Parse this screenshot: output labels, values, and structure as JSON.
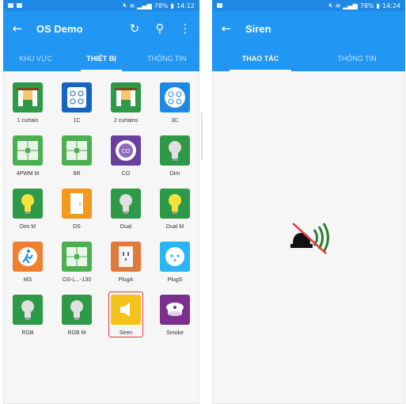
{
  "left_phone": {
    "status_time": "14:12",
    "status_battery": "78%",
    "title": "OS Demo",
    "tabs": [
      {
        "label": "KHU VỰC",
        "active": false
      },
      {
        "label": "THIẾT BỊ",
        "active": true
      },
      {
        "label": "THÔNG TIN",
        "active": false
      }
    ],
    "devices": [
      {
        "label": "1 curtain",
        "icon": "curtain-icon",
        "color": "#2e9a48"
      },
      {
        "label": "1C",
        "icon": "remote-1c-icon",
        "color": "#1565c0"
      },
      {
        "label": "2 curtains",
        "icon": "curtain-icon",
        "color": "#2e9a48"
      },
      {
        "label": "3C",
        "icon": "remote-3c-icon",
        "color": "#1e88e5"
      },
      {
        "label": "4PWM M",
        "icon": "switch-panel-icon",
        "color": "#4caf50"
      },
      {
        "label": "6R",
        "icon": "switch-panel-icon",
        "color": "#4caf50"
      },
      {
        "label": "CO",
        "icon": "co-sensor-icon",
        "color": "#6a3fa0"
      },
      {
        "label": "Dim",
        "icon": "bulb-icon",
        "color": "#2e9a48"
      },
      {
        "label": "Dim M",
        "icon": "bulb-on-icon",
        "color": "#2e9a48"
      },
      {
        "label": "DS",
        "icon": "door-icon",
        "color": "#f39a1c"
      },
      {
        "label": "Dual",
        "icon": "bulb-icon",
        "color": "#2e9a48"
      },
      {
        "label": "Dual M",
        "icon": "bulb-on-icon",
        "color": "#2e9a48"
      },
      {
        "label": "MS",
        "icon": "motion-sensor-icon",
        "color": "#f08030"
      },
      {
        "label": "OS-L...-130",
        "icon": "switch-panel-icon",
        "color": "#4caf50"
      },
      {
        "label": "PlugA",
        "icon": "plug-icon",
        "color": "#e07a3a"
      },
      {
        "label": "PlugS",
        "icon": "plug-s-icon",
        "color": "#29b6f6"
      },
      {
        "label": "RGB",
        "icon": "bulb-icon",
        "color": "#2e9a48"
      },
      {
        "label": "RGB M",
        "icon": "bulb-icon",
        "color": "#2e9a48"
      },
      {
        "label": "Siren",
        "icon": "siren-icon",
        "color": "#f4c21b"
      },
      {
        "label": "Smoke",
        "icon": "smoke-detector-icon",
        "color": "#7b2f8e"
      }
    ],
    "selected_device": "Siren"
  },
  "right_phone": {
    "status_time": "14:24",
    "status_battery": "78%",
    "title": "Siren",
    "tabs": [
      {
        "label": "THAO TÁC",
        "active": true
      },
      {
        "label": "THÔNG TIN",
        "active": false
      }
    ],
    "status_icon": "siren-muted-icon"
  },
  "colors": {
    "primary": "#2196f3",
    "status_bar": "#1e88e5",
    "selection": "#e53935"
  }
}
